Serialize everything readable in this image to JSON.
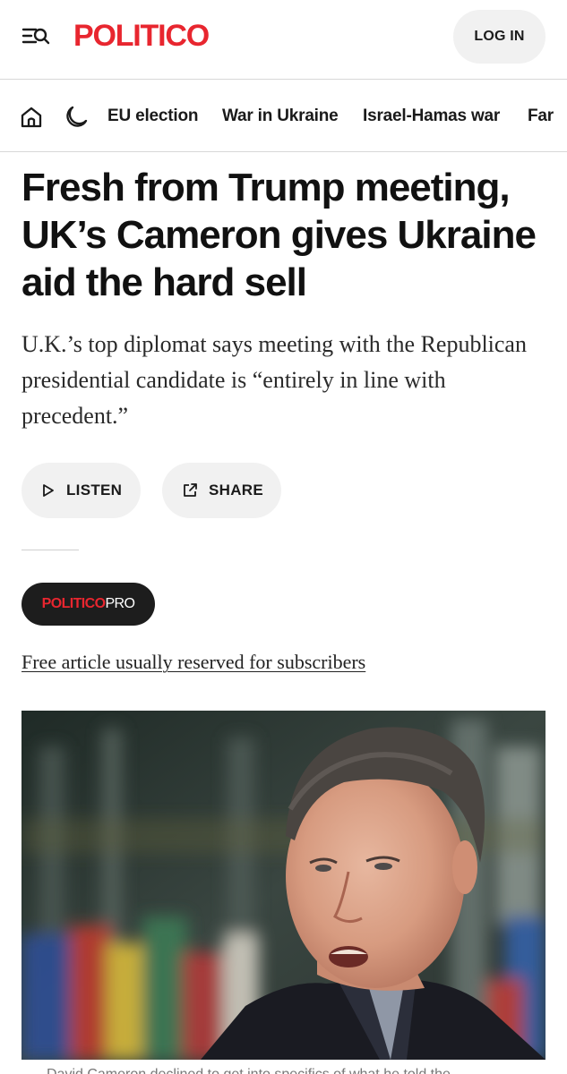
{
  "header": {
    "logo": "POLITICO",
    "login_label": "LOG IN",
    "menu_icon": "menu-search-icon"
  },
  "nav": {
    "home_icon": "home-icon",
    "theme_icon": "moon-icon",
    "links": [
      "EU election",
      "War in Ukraine",
      "Israel-Hamas war",
      "Far"
    ]
  },
  "article": {
    "headline": "Fresh from Trump meeting, UK’s Cameron gives Ukraine aid the hard sell",
    "dek": "U.K.’s top diplomat says meeting with the Republican presidential candidate is “entirely in line with precedent.”",
    "listen_label": "LISTEN",
    "share_label": "SHARE",
    "pro_badge": {
      "part1": "POLITICO",
      "part2": "PRO"
    },
    "free_note": "Free article usually reserved for subscribers",
    "caption_partial": "David Cameron declined to get into specifics of what he told the"
  },
  "colors": {
    "brand_red": "#e8262f",
    "button_bg": "#f1f1f1",
    "badge_bg": "#1d1d1d"
  }
}
